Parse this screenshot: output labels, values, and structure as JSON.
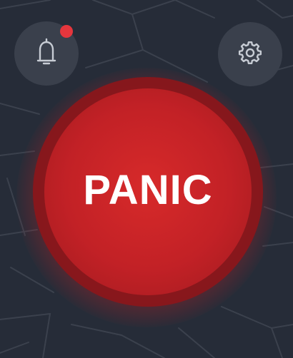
{
  "colors": {
    "background": "#262c38",
    "map_roads": "#3b414d",
    "icon_button_bg": "#3a404c",
    "icon_stroke": "#c7ccd4",
    "notification_badge": "#e5363d",
    "panic_red": "#c22126",
    "panic_ring": "#8c161a"
  },
  "top_bar": {
    "notifications": {
      "icon": "bell-icon",
      "has_unread": true
    },
    "settings": {
      "icon": "gear-icon"
    }
  },
  "panic": {
    "label": "PANIC"
  }
}
